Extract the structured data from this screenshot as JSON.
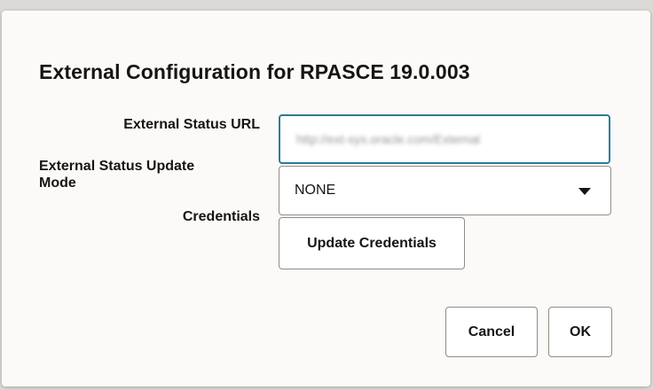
{
  "dialog": {
    "title": "External Configuration for RPASCE 19.0.003"
  },
  "form": {
    "external_status_url": {
      "label": "External Status URL",
      "value": "http://ext-sys.oracle.com/External"
    },
    "external_status_update_mode": {
      "label": "External Status Update Mode",
      "selected": "NONE"
    },
    "credentials": {
      "label": "Credentials",
      "button_label": "Update Credentials"
    }
  },
  "footer": {
    "cancel_label": "Cancel",
    "ok_label": "OK"
  },
  "colors": {
    "focus_border": "#227e9e",
    "dialog_bg": "#fcfaf9",
    "text": "#161513"
  },
  "icons": {
    "select_caret": "caret-down-icon"
  }
}
